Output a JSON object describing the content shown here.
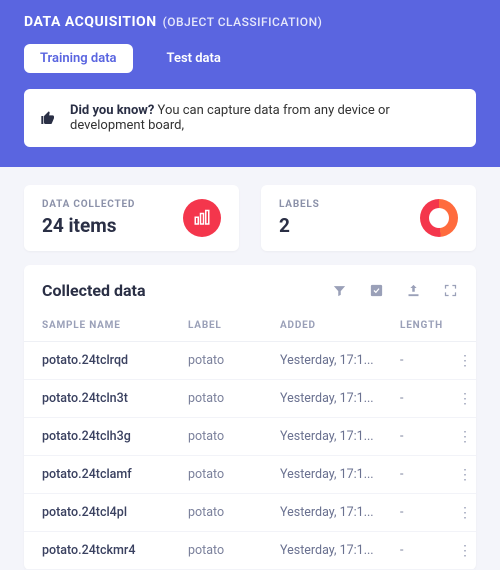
{
  "header": {
    "title": "DATA ACQUISITION",
    "subtitle": "(OBJECT CLASSIFICATION)"
  },
  "tabs": {
    "training": "Training data",
    "test": "Test data"
  },
  "banner": {
    "strong": "Did you know?",
    "text": " You can capture data from any device or development board,"
  },
  "stats": {
    "collected_label": "DATA COLLECTED",
    "collected_value": "24 items",
    "labels_label": "LABELS",
    "labels_value": "2"
  },
  "panel": {
    "title": "Collected data"
  },
  "columns": {
    "name": "SAMPLE NAME",
    "label": "LABEL",
    "added": "ADDED",
    "length": "LENGTH"
  },
  "rows": [
    {
      "name": "potato.24tclrqd",
      "label": "potato",
      "added": "Yesterday, 17:1...",
      "length": "-"
    },
    {
      "name": "potato.24tcln3t",
      "label": "potato",
      "added": "Yesterday, 17:1...",
      "length": "-"
    },
    {
      "name": "potato.24tclh3g",
      "label": "potato",
      "added": "Yesterday, 17:1...",
      "length": "-"
    },
    {
      "name": "potato.24tclamf",
      "label": "potato",
      "added": "Yesterday, 17:1...",
      "length": "-"
    },
    {
      "name": "potato.24tcl4pl",
      "label": "potato",
      "added": "Yesterday, 17:1...",
      "length": "-"
    },
    {
      "name": "potato.24tckmr4",
      "label": "potato",
      "added": "Yesterday, 17:1...",
      "length": "-"
    }
  ]
}
